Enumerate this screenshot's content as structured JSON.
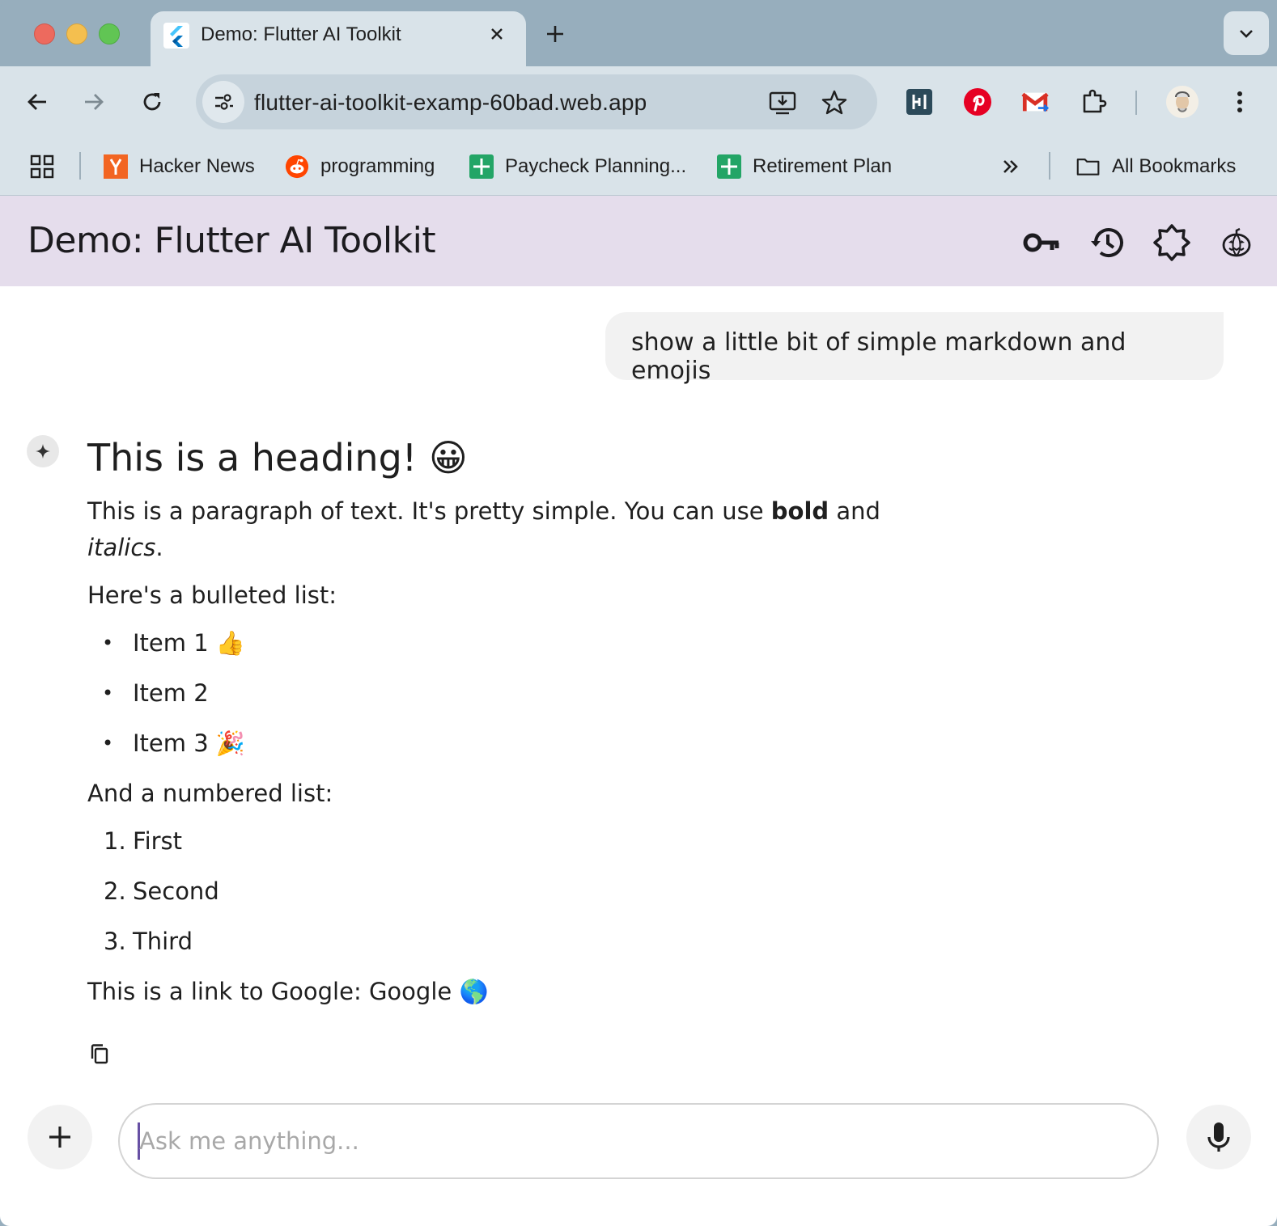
{
  "browser": {
    "tab_title": "Demo: Flutter AI Toolkit",
    "url": "flutter-ai-toolkit-examp-60bad.web.app",
    "bookmarks": [
      {
        "label": "Hacker News",
        "icon": "hacker-news-icon",
        "color": "#f26522"
      },
      {
        "label": "programming",
        "icon": "reddit-icon",
        "color": "#ff4500"
      },
      {
        "label": "Paycheck Planning...",
        "icon": "sheets-icon",
        "color": "#23a566"
      },
      {
        "label": "Retirement Plan",
        "icon": "sheets-icon",
        "color": "#23a566"
      }
    ],
    "all_bookmarks_label": "All Bookmarks"
  },
  "app": {
    "title": "Demo: Flutter AI Toolkit",
    "actions": [
      "key-icon",
      "history-icon",
      "brightness-icon",
      "pumpkin-icon"
    ]
  },
  "chat": {
    "user_message": "show a little bit of simple markdown and emojis",
    "response": {
      "heading": "This is a heading! 😀",
      "paragraph_start": "This is a paragraph of text.  It's pretty simple.  You can use ",
      "bold_word": "bold",
      "paragraph_and": " and",
      "italic_word": "italics",
      "paragraph_end": ".",
      "bullet_intro": "Here's a bulleted list:",
      "bullets": [
        "Item 1 👍",
        "Item 2",
        "Item 3 🎉"
      ],
      "numbered_intro": "And a numbered list:",
      "numbered": [
        "First",
        "Second",
        "Third"
      ],
      "numbered_marks": [
        "1.",
        "2.",
        "3."
      ],
      "link_prefix": "This is a link to Google: ",
      "link_text": "Google",
      "link_emoji": "🌎"
    }
  },
  "input": {
    "placeholder": "Ask me anything..."
  },
  "colors": {
    "appbar": "#e5ddec",
    "accent": "#6750a4",
    "user_bubble": "#f2f2f2"
  }
}
